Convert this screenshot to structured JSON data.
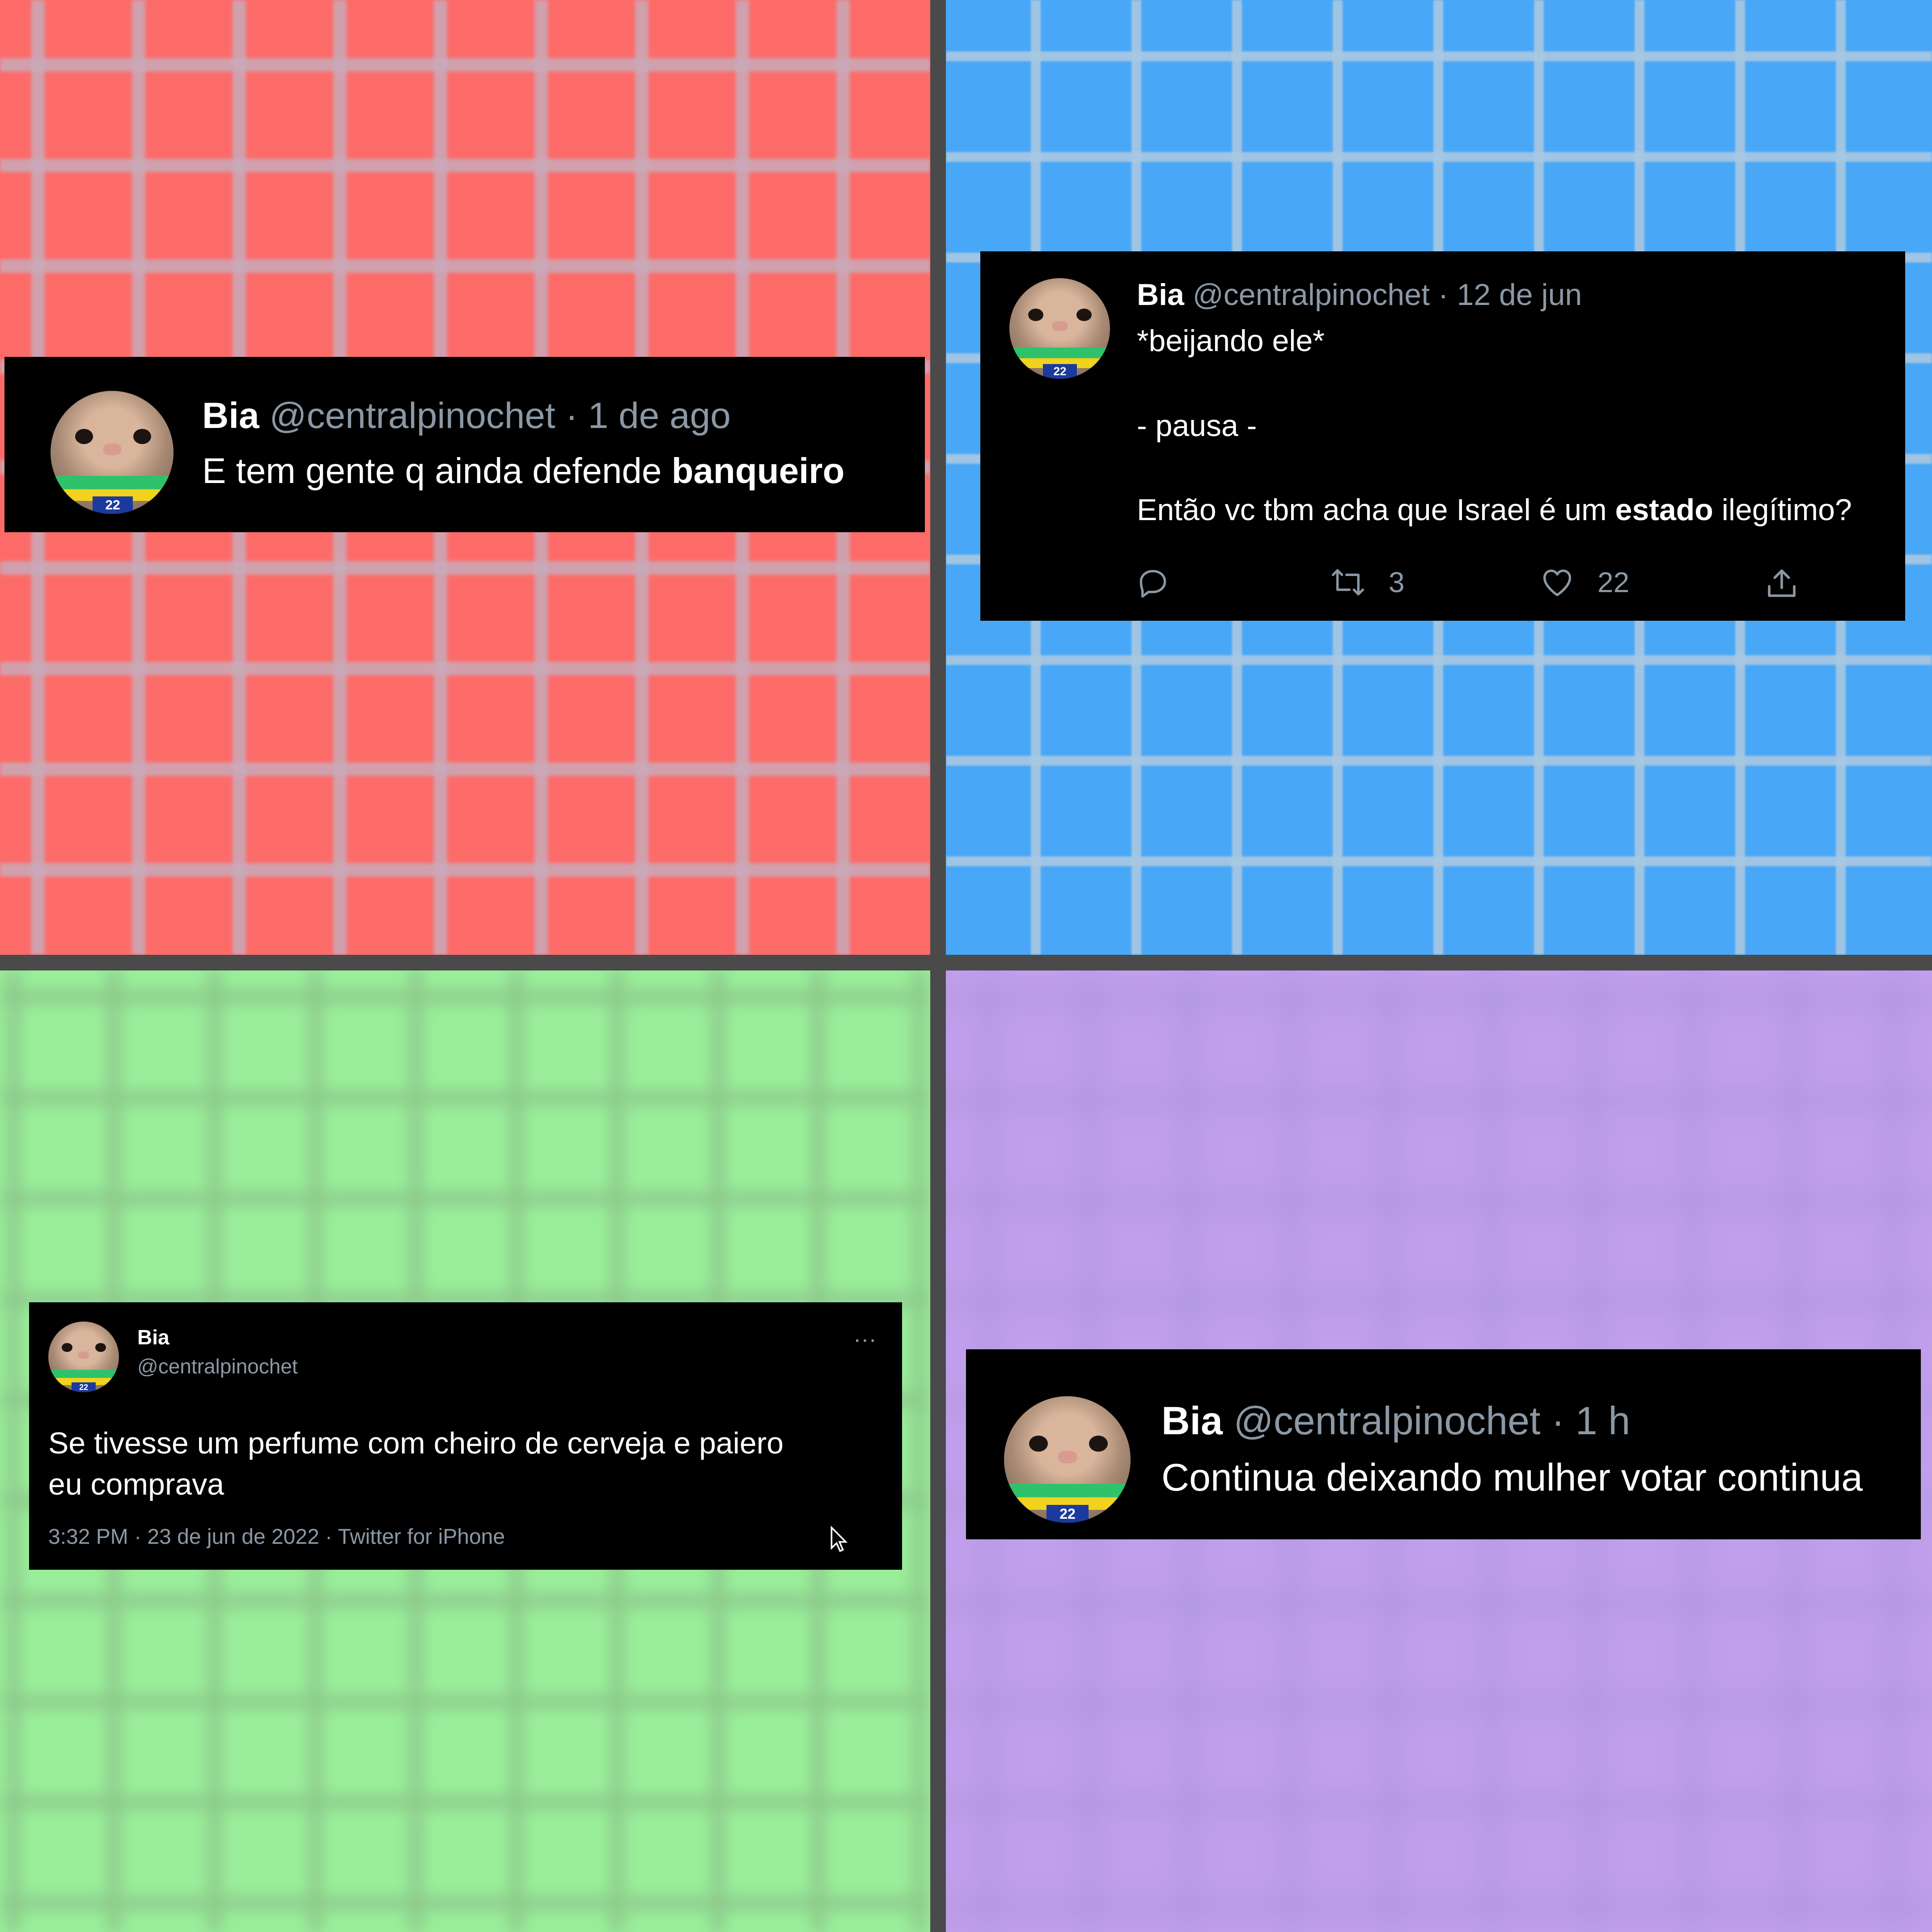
{
  "tweet1": {
    "name": "Bia",
    "handle": "@centralpinochet",
    "sep": "·",
    "time": "1 de ago",
    "text_pre": "E tem gente q ainda defende ",
    "text_bold": "banqueiro",
    "avatar_badge": "22"
  },
  "tweet2": {
    "name": "Bia",
    "handle": "@centralpinochet",
    "sep": "·",
    "time": "12 de jun",
    "line1": "*beijando ele*",
    "line2": "- pausa -",
    "line3_pre": "Então vc tbm acha que Israel é um ",
    "line3_bold": "estado",
    "line3_post": " ilegítimo?",
    "retweets": "3",
    "likes": "22",
    "avatar_badge": "22",
    "icons": [
      "reply-icon",
      "retweet-icon",
      "like-icon",
      "share-icon"
    ]
  },
  "tweet3": {
    "name": "Bia",
    "handle": "@centralpinochet",
    "more": "···",
    "text_line1": "Se tivesse um perfume com cheiro de cerveja e paiero",
    "text_line2": "eu comprava",
    "meta": "3:32 PM · 23 de jun de 2022 · Twitter for iPhone",
    "avatar_badge": "22"
  },
  "tweet4": {
    "name": "Bia",
    "handle": "@centralpinochet",
    "sep": "·",
    "time": "1 h",
    "text": "Continua deixando mulher votar continua",
    "avatar_badge": "22"
  },
  "colors": {
    "red": "#fd6b69",
    "blue": "#48a7f6",
    "green": "#9aee9a",
    "purple": "#c09fec",
    "tweet_bg": "#000000",
    "muted_text": "#8b98a5"
  }
}
